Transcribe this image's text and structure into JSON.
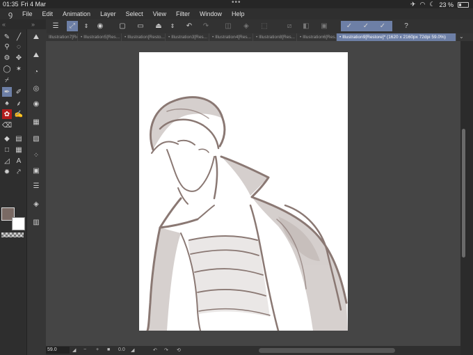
{
  "status": {
    "time": "01:35",
    "date": "Fri 4 Mar",
    "battery": "23 %",
    "battery_level": 0.23,
    "dots": "•••"
  },
  "menu": {
    "logo_icon": "clip-studio-logo-icon",
    "items": [
      "File",
      "Edit",
      "Animation",
      "Layer",
      "Select",
      "View",
      "Filter",
      "Window",
      "Help"
    ]
  },
  "tabs": [
    {
      "label": "Illustration7[Re..."
    },
    {
      "label": "• Illustration5[Res..."
    },
    {
      "label": "• Illustration[Resto..."
    },
    {
      "label": "• Illustration3[Res..."
    },
    {
      "label": "• Illustration4[Res..."
    },
    {
      "label": "• Illustration8[Res..."
    },
    {
      "label": "• Illustration6[Res..."
    },
    {
      "label": "• Illustration9[Restore]* (1620 x 2160px 72dpi 59.0%)"
    }
  ],
  "tab_close": "×",
  "bottom": {
    "zoom": "59.0",
    "angle": "0.0",
    "minus": "−",
    "plus": "+",
    "stop": "■"
  },
  "colors": {
    "main": "#7a6a64",
    "sub": "#ffffff",
    "accent": "#6d7fa6",
    "sketch": "#8a7873"
  }
}
